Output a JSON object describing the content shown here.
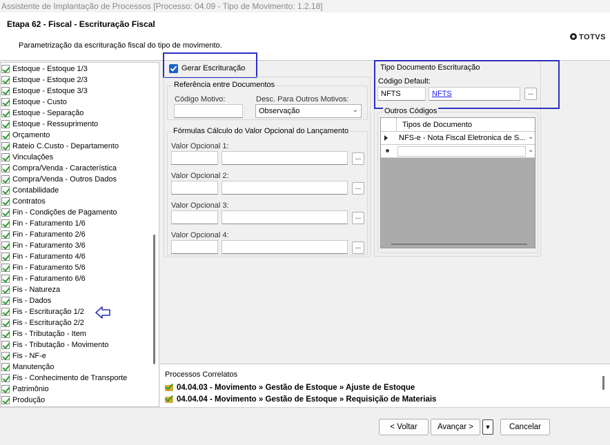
{
  "window": {
    "title": "Assistente de Implantação de Processos [Processo: 04.09 - Tipo de Movimento: 1.2.18]"
  },
  "header": {
    "step_title": "Etapa 62 - Fiscal - Escrituração Fiscal",
    "description": "Parametrização da escrituração fiscal do tipo de movimento.",
    "logo_text": "TOTVS"
  },
  "sidebar": {
    "items": [
      "Estoque - Estoque 1/3",
      "Estoque - Estoque 2/3",
      "Estoque - Estoque 3/3",
      "Estoque - Custo",
      "Estoque - Separação",
      "Estoque - Ressuprimento",
      "Orçamento",
      "Rateio C.Custo - Departamento",
      "Vinculações",
      "Compra/Venda - Característica",
      "Compra/Venda - Outros Dados",
      "Contabilidade",
      "Contratos",
      "Fin - Condições de Pagamento",
      "Fin - Faturamento 1/6",
      "Fin - Faturamento 2/6",
      "Fin - Faturamento 3/6",
      "Fin - Faturamento 4/6",
      "Fin - Faturamento 5/6",
      "Fin - Faturamento 6/6",
      "Fis - Natureza",
      "Fis - Dados",
      "Fis - Escrituração 1/2",
      "Fis - Escrituração 2/2",
      "Fis - Tributação - Item",
      "Fis - Tributação - Movimento",
      "Fis - NF-e",
      "Manutenção",
      "Fis - Conhecimento de Transporte",
      "Patrimônio",
      "Produção"
    ]
  },
  "form": {
    "gerar_escrituracao": {
      "label": "Gerar Escrituração",
      "checked": true
    },
    "referencia": {
      "title": "Referência entre Documentos",
      "codigo_motivo_label": "Código Motivo:",
      "codigo_motivo_value": "",
      "desc_outros_label": "Desc. Para Outros Motivos:",
      "desc_outros_value": "Observação"
    },
    "formulas": {
      "title": "Fórmulas Cálculo do Valor Opcional do Lançamento",
      "labels": [
        "Valor Opcional 1:",
        "Valor Opcional 2:",
        "Valor Opcional 3:",
        "Valor Opcional 4:"
      ],
      "dots": "..."
    },
    "tipo_documento": {
      "title": "Tipo Documento Escrituração",
      "codigo_default_label": "Código Default:",
      "codigo_value": "NFTS",
      "link_value": "NFTS",
      "dots": "..."
    },
    "outros_codigos": {
      "title": "Outros Códigos",
      "column_header": "Tipos de Documento",
      "rows": [
        "NFS-e - Nota Fiscal Eletronica de S...",
        ""
      ]
    }
  },
  "correlatos": {
    "title": "Processos Correlatos",
    "items": [
      "04.04.03 - Movimento » Gestão de Estoque » Ajuste de Estoque",
      "04.04.04 - Movimento » Gestão de Estoque » Requisição de Materiais"
    ]
  },
  "footer": {
    "voltar": "< Voltar",
    "avancar": "Avançar >",
    "cancelar": "Cancelar"
  },
  "colors": {
    "annotation": "#2a2fc0",
    "check_blue": "#1a62c8",
    "link": "#1a1ae6"
  }
}
